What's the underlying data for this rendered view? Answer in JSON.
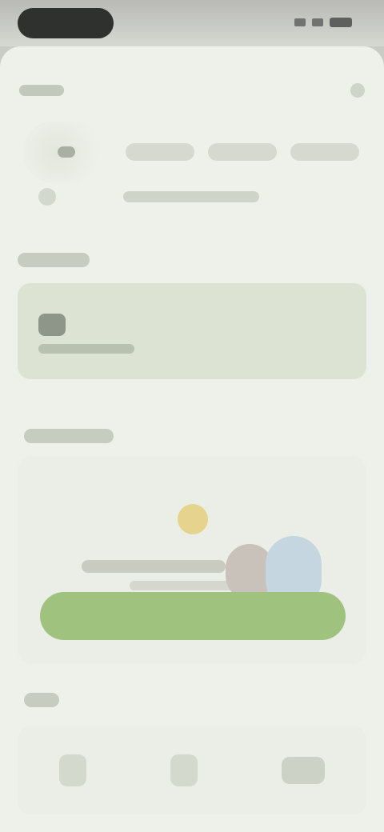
{
  "status_bar": {
    "time": "",
    "icons": [
      "signal-icon",
      "wifi-icon",
      "battery-icon"
    ]
  },
  "header": {
    "back_label": "",
    "menu_icon": "more-icon"
  },
  "profile": {
    "avatar_icon": "avatar-icon",
    "stats": [
      {
        "label": ""
      },
      {
        "label": ""
      },
      {
        "label": ""
      }
    ],
    "location_icon": "pin-icon",
    "location_text": ""
  },
  "sections": {
    "notice_title": "",
    "promo_title": "",
    "tools_title": ""
  },
  "notice": {
    "icon": "notice-icon",
    "text": ""
  },
  "promo": {
    "button_label": ""
  },
  "tools": [
    {
      "icon": "tool-icon-1"
    },
    {
      "icon": "tool-icon-2"
    },
    {
      "icon": "tool-icon-3"
    }
  ],
  "colors": {
    "background": "#eef1ea",
    "accent_green": "#9fc27f",
    "notice_card": "#dde3d3",
    "sun_yellow": "#e6d38e",
    "blob_blue": "#c5d6e0"
  }
}
